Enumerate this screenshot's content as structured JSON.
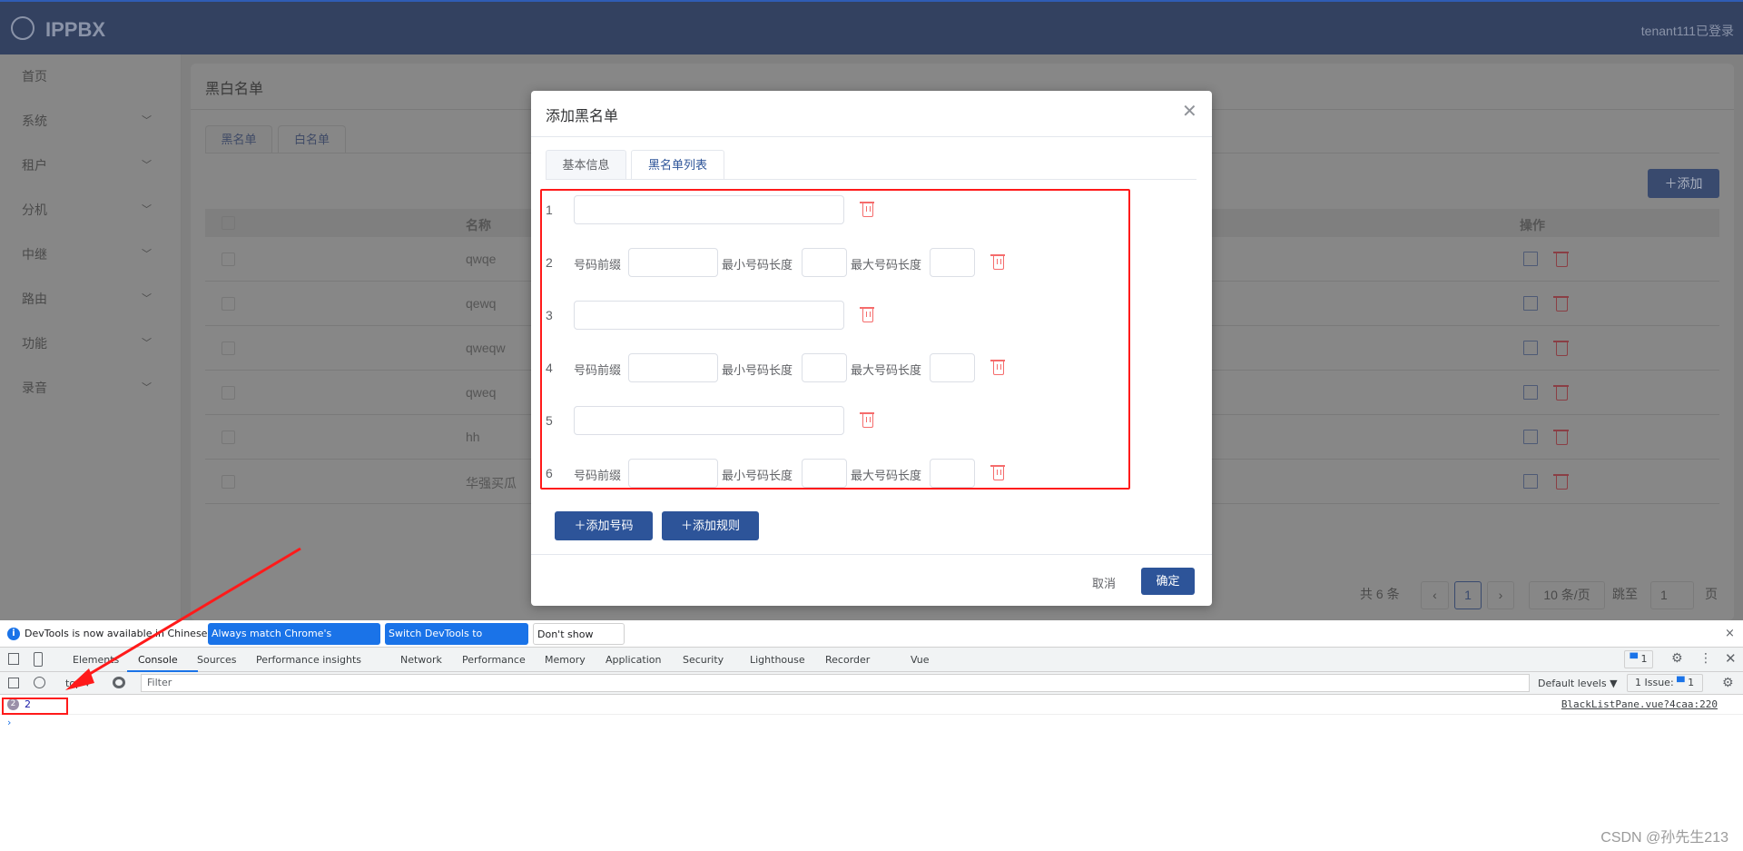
{
  "app": {
    "logo": "IPPBX",
    "user": "tenant111已登录"
  },
  "sidebar": {
    "items": [
      {
        "label": "首页",
        "chev": false
      },
      {
        "label": "系统",
        "chev": true
      },
      {
        "label": "租户",
        "chev": true
      },
      {
        "label": "分机",
        "chev": true
      },
      {
        "label": "中继",
        "chev": true
      },
      {
        "label": "路由",
        "chev": true
      },
      {
        "label": "功能",
        "chev": true
      },
      {
        "label": "录音",
        "chev": true
      }
    ]
  },
  "page": {
    "title": "黑白名单",
    "tabs": [
      "黑名单",
      "白名单"
    ],
    "add_label": "添加",
    "table": {
      "headers": [
        "名称",
        "操作"
      ],
      "rows": [
        "qwqe",
        "qewq",
        "qweqw",
        "qweq",
        "hh",
        "华强买瓜"
      ]
    },
    "pagination": {
      "total": "共 6 条",
      "page": "1",
      "size": "10 条/页",
      "jump_label": "跳至",
      "jump_value": "1",
      "page_suffix": "页"
    }
  },
  "modal": {
    "title": "添加黑名单",
    "tabs": [
      "基本信息",
      "黑名单列表"
    ],
    "active_tab": 1,
    "rows": [
      {
        "num": "1",
        "type": "number"
      },
      {
        "num": "2",
        "type": "rule"
      },
      {
        "num": "3",
        "type": "number"
      },
      {
        "num": "4",
        "type": "rule"
      },
      {
        "num": "5",
        "type": "number"
      },
      {
        "num": "6",
        "type": "rule"
      }
    ],
    "rule_labels": {
      "prefix": "号码前缀",
      "min": "最小号码长度",
      "max": "最大号码长度"
    },
    "add_number": "添加号码",
    "add_rule": "添加规则",
    "cancel": "取消",
    "ok": "确定"
  },
  "devtools": {
    "info": "DevTools is now available in Chinese!",
    "btn_match": "Always match Chrome's language",
    "btn_switch": "Switch DevTools to Chinese",
    "btn_dont": "Don't show again",
    "tabs": [
      "Elements",
      "Console",
      "Sources",
      "Performance insights",
      "Network",
      "Performance",
      "Memory",
      "Application",
      "Security",
      "Lighthouse",
      "Recorder",
      "Vue"
    ],
    "active_tab": "Console",
    "issues_badge": "1",
    "context": "top",
    "filter_placeholder": "Filter",
    "levels": "Default levels ▼",
    "issues": "1 Issue:",
    "issues_count": "1",
    "log": {
      "count": "2",
      "value": "2",
      "source": "BlackListPane.vue?4caa:220"
    },
    "prompt": "›"
  },
  "watermark": "CSDN @孙先生213",
  "colors": {
    "primary": "#2d5499",
    "danger": "#f56c6c",
    "highlight": "#ff1a1a",
    "devtools_blue": "#1a73e8"
  }
}
